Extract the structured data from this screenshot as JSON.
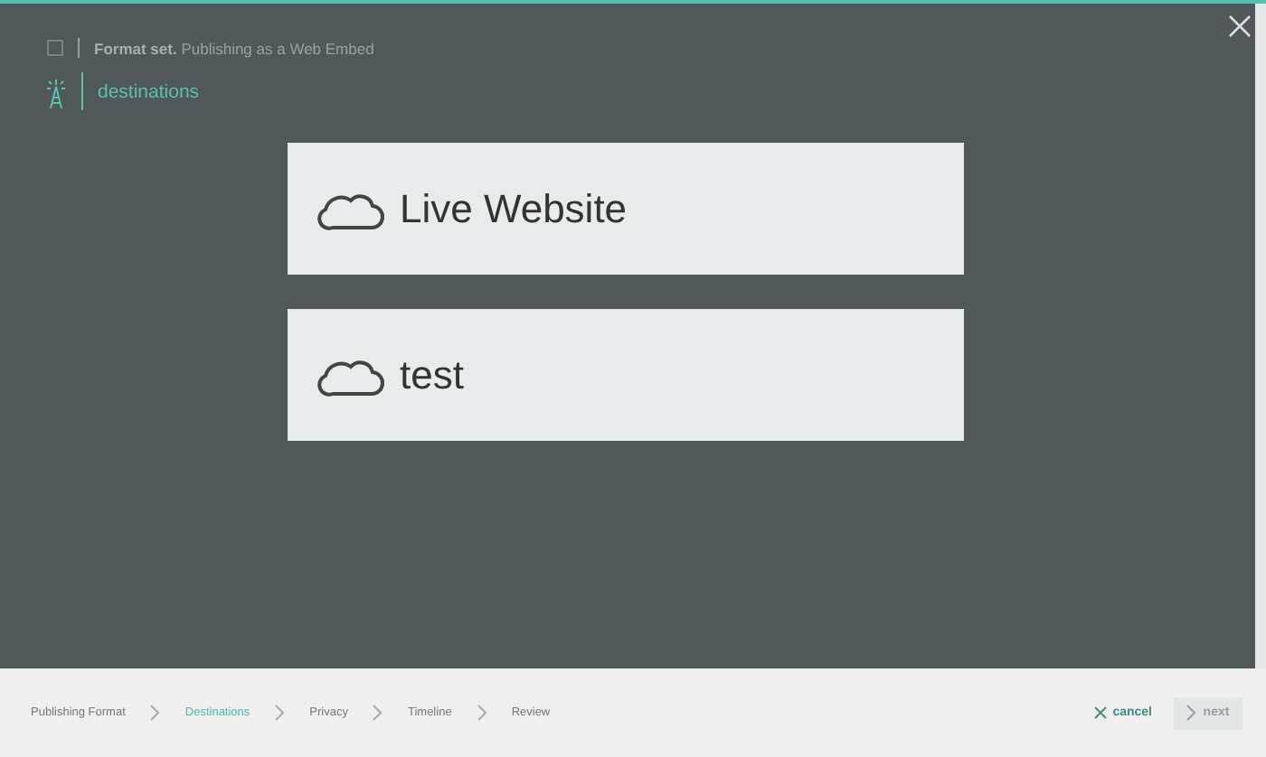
{
  "header": {
    "status": "**Format set.** Publishing as a Web Embed",
    "section": "destinations"
  },
  "destinations": [
    {
      "label": "Live Website"
    },
    {
      "label": "test"
    }
  ],
  "steps": [
    {
      "label": "Publishing Format",
      "selected": false
    },
    {
      "label": "Destinations",
      "selected": true
    },
    {
      "label": "Privacy",
      "selected": false
    },
    {
      "label": "Timeline",
      "selected": false
    },
    {
      "label": "Review",
      "selected": false
    }
  ],
  "actions": {
    "cancel": "cancel",
    "next": "next",
    "next_disabled": true
  }
}
